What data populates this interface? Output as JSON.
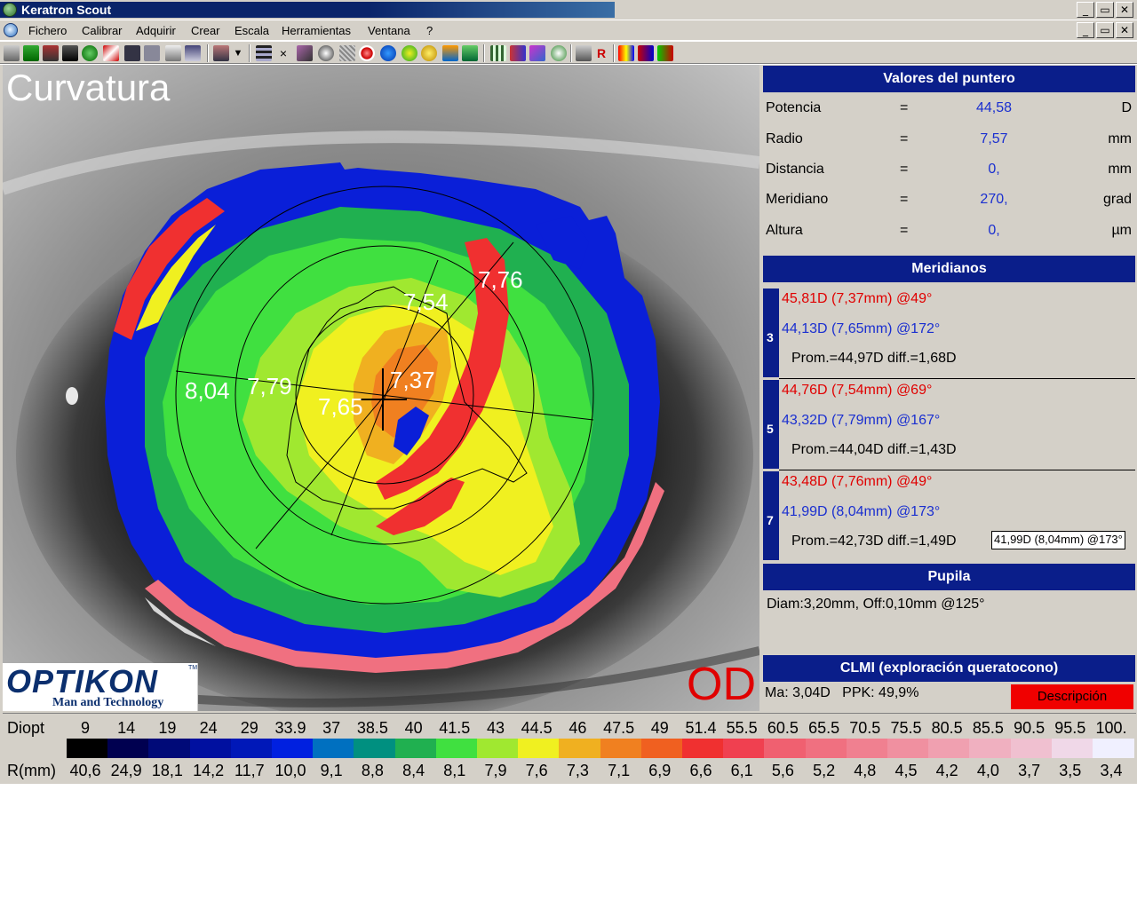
{
  "window": {
    "title": "Keratron Scout",
    "buttons": [
      "_",
      "▭",
      "✕"
    ]
  },
  "menu": {
    "items": [
      "Fichero",
      "Calibrar",
      "Adquirir",
      "Crear",
      "Escala",
      "Herramientas",
      "Ventana",
      "?"
    ]
  },
  "map": {
    "title": "Curvatura",
    "eye": "OD",
    "labels": [
      "8,04",
      "7,79",
      "7,65",
      "7,37",
      "7,54",
      "7,76"
    ]
  },
  "logo": {
    "brand": "OPTIKON",
    "tagline": "Man and Technology",
    "tm": "TM"
  },
  "pointer": {
    "title": "Valores del puntero",
    "rows": [
      {
        "name": "Potencia",
        "eq": "=",
        "value": "44,58",
        "unit": "D"
      },
      {
        "name": "Radio",
        "eq": "=",
        "value": "7,57",
        "unit": "mm"
      },
      {
        "name": "Distancia",
        "eq": "=",
        "value": "0,",
        "unit": "mm"
      },
      {
        "name": "Meridiano",
        "eq": "=",
        "value": "270,",
        "unit": "grad"
      },
      {
        "name": "Altura",
        "eq": "=",
        "value": "0,",
        "unit": "µm"
      }
    ]
  },
  "meridians": {
    "title": "Meridianos",
    "blocks": [
      {
        "num": "3",
        "steep": "45,81D (7,37mm) @49°",
        "flat": "44,13D (7,65mm) @172°",
        "summary": "Prom.=44,97D  diff.=1,68D"
      },
      {
        "num": "5",
        "steep": "44,76D (7,54mm) @69°",
        "flat": "43,32D (7,79mm) @167°",
        "summary": "Prom.=44,04D  diff.=1,43D"
      },
      {
        "num": "7",
        "steep": "43,48D (7,76mm) @49°",
        "flat": "41,99D (8,04mm) @173°",
        "summary": "Prom.=42,73D  diff.=1,49D"
      }
    ],
    "tooltip": "41,99D (8,04mm) @173°"
  },
  "pupil": {
    "title": "Pupila",
    "text": "Diam:3,20mm, Off:0,10mm @125°"
  },
  "clmi": {
    "title": "CLMI (exploración queratocono)",
    "text": "Ma: 3,04D   PPK: 49,9%",
    "button": "Descripción",
    "button_color": "#f00000"
  },
  "scale": {
    "diopt_label": "Diopt",
    "r_label": "R(mm)",
    "diopt": [
      "9",
      "14",
      "19",
      "24",
      "29",
      "33.9",
      "37",
      "38.5",
      "40",
      "41.5",
      "43",
      "44.5",
      "46",
      "47.5",
      "49",
      "51.4",
      "55.5",
      "60.5",
      "65.5",
      "70.5",
      "75.5",
      "80.5",
      "85.5",
      "90.5",
      "95.5",
      "100."
    ],
    "r": [
      "40,6",
      "24,9",
      "18,1",
      "14,2",
      "11,7",
      "10,0",
      "9,1",
      "8,8",
      "8,4",
      "8,1",
      "7,9",
      "7,6",
      "7,3",
      "7,1",
      "6,9",
      "6,6",
      "6,1",
      "5,6",
      "5,2",
      "4,8",
      "4,5",
      "4,2",
      "4,0",
      "3,7",
      "3,5",
      "3,4"
    ],
    "colors": [
      "#000000",
      "#000050",
      "#000a78",
      "#0010a0",
      "#0018b8",
      "#0020e0",
      "#0070c0",
      "#009080",
      "#20b050",
      "#40e040",
      "#a0e830",
      "#f0f020",
      "#f0b020",
      "#f08020",
      "#f06020",
      "#f03030",
      "#f04050",
      "#f06070",
      "#f07080",
      "#f08090",
      "#f090a0",
      "#f0a0b0",
      "#f0b0c0",
      "#f0c0d0",
      "#f0d8e8",
      "#f0f0ff"
    ]
  }
}
